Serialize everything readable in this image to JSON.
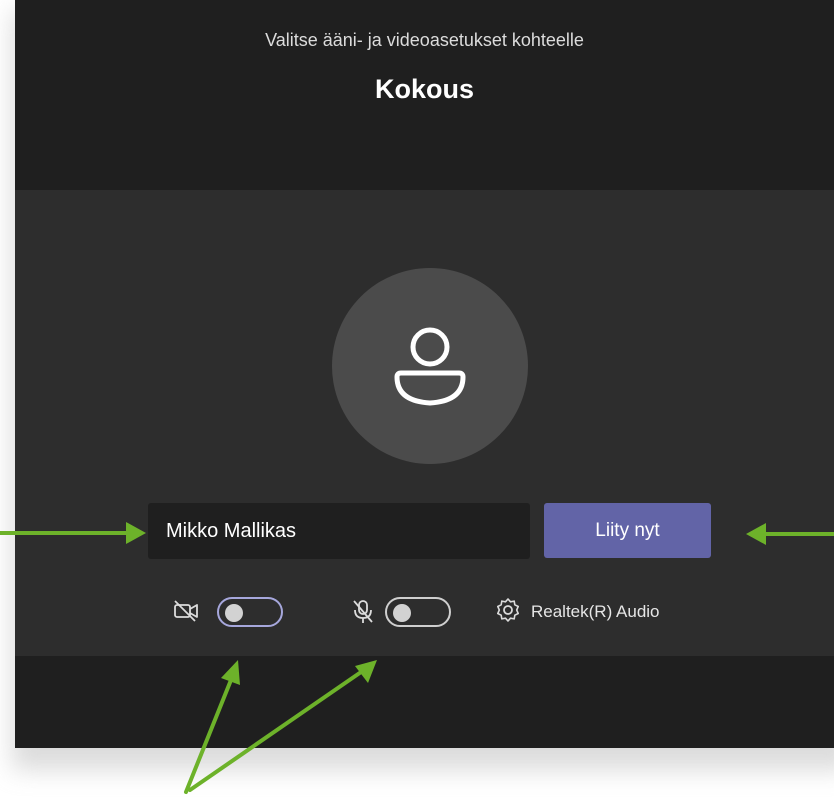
{
  "header": {
    "subtitle": "Valitse ääni- ja videoasetukset kohteelle",
    "meeting_title": "Kokous"
  },
  "name_input": {
    "value": "Mikko Mallikas"
  },
  "join_button": {
    "label": "Liity nyt"
  },
  "controls": {
    "camera_icon": "video-off-icon",
    "camera_toggle_on": false,
    "mic_icon": "mic-off-icon",
    "mic_toggle_on": false,
    "settings_icon": "gear-icon",
    "audio_device_label": "Realtek(R) Audio"
  },
  "colors": {
    "accent": "#6264a7",
    "annotation_arrow": "#6db22a",
    "background_dark": "#1f1f1f",
    "panel": "#2d2d2d"
  }
}
